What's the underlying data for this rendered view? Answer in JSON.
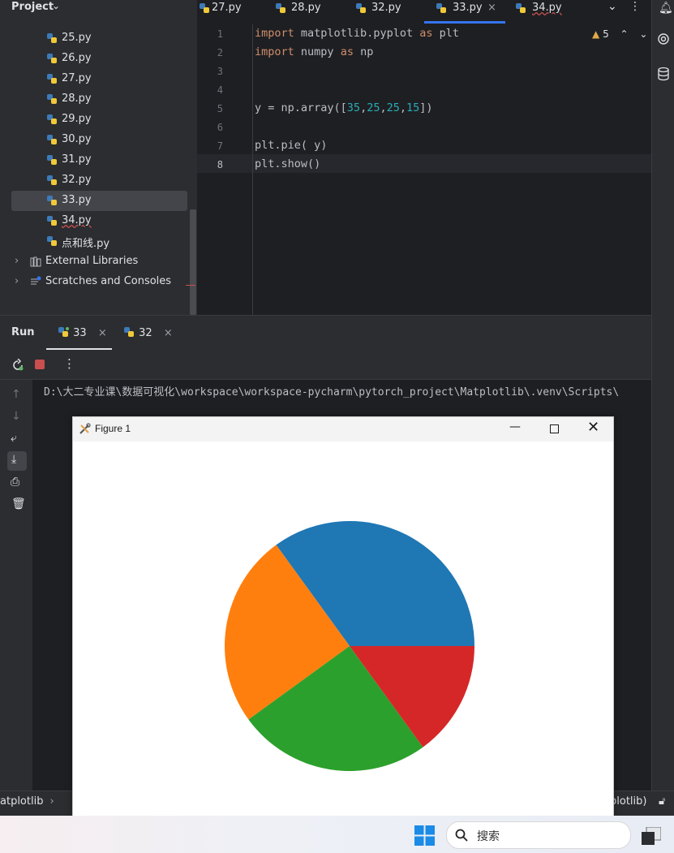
{
  "project": {
    "title": "Project",
    "items": [
      {
        "label": "25.py"
      },
      {
        "label": "26.py"
      },
      {
        "label": "27.py"
      },
      {
        "label": "28.py"
      },
      {
        "label": "29.py"
      },
      {
        "label": "30.py"
      },
      {
        "label": "31.py"
      },
      {
        "label": "32.py"
      },
      {
        "label": "33.py",
        "selected": true
      },
      {
        "label": "34.py"
      },
      {
        "label": "点和线.py"
      }
    ],
    "external_libraries": "External Libraries",
    "scratches": "Scratches and Consoles"
  },
  "editor": {
    "tabs": [
      "27.py",
      "28.py",
      "32.py",
      "33.py",
      "34.py"
    ],
    "active_tab": "33.py",
    "warnings": "5",
    "line_numbers": [
      "1",
      "2",
      "3",
      "4",
      "5",
      "6",
      "7",
      "8"
    ],
    "lines": {
      "l1_kw1": "import",
      "l1_mod": " matplotlib.pyplot ",
      "l1_kw2": "as",
      "l1_alias": " plt",
      "l2_kw1": "import",
      "l2_mod": " numpy ",
      "l2_kw2": "as",
      "l2_alias": " np",
      "l5_pre": "y = np.array([",
      "l5_n1": "35",
      "l5_n2": "25",
      "l5_n3": "25",
      "l5_n4": "15",
      "l5_post": "])",
      "l7": "plt.pie( y)",
      "l8": "plt.show()"
    }
  },
  "run": {
    "title": "Run",
    "tabs": [
      "33",
      "32"
    ],
    "path": "D:\\大二专业课\\数据可视化\\workspace\\workspace-pycharm\\pytorch_project\\Matplotlib\\.venv\\Scripts\\"
  },
  "status": {
    "left": "atplotlib",
    "right": "plotlib)"
  },
  "figure": {
    "title": "Figure 1"
  },
  "taskbar": {
    "search": "搜索"
  },
  "chart_data": {
    "type": "pie",
    "values": [
      35,
      25,
      25,
      15
    ],
    "colors": [
      "#1f77b4",
      "#ff7f0e",
      "#2ca02c",
      "#d62728"
    ],
    "start_angle": 0,
    "direction": "counterclockwise"
  }
}
